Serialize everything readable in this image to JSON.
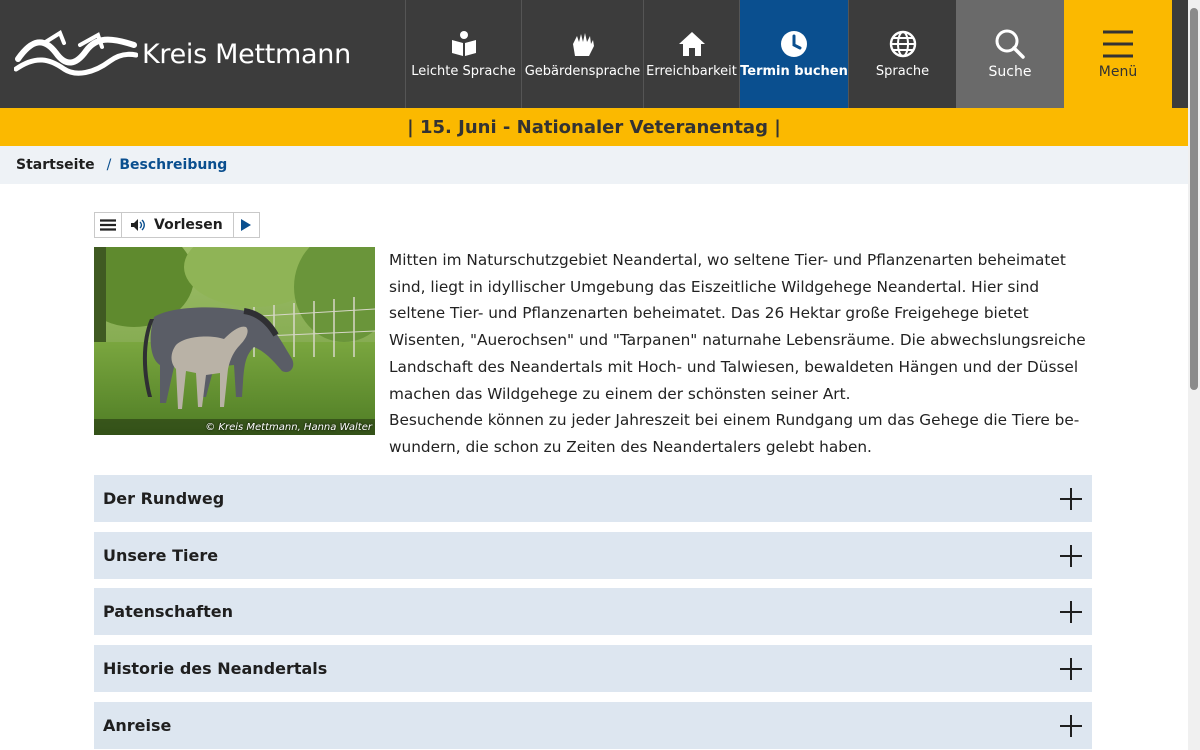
{
  "header": {
    "logo_text": "Kreis Mettmann",
    "nav": [
      {
        "label": "Leichte Sprache",
        "icon": "book-reader-icon"
      },
      {
        "label": "Gebärdensprache",
        "icon": "sign-language-icon"
      },
      {
        "label": "Erreichbarkeit",
        "icon": "home-icon"
      },
      {
        "label": "Termin buchen",
        "icon": "clock-icon"
      },
      {
        "label": "Sprache",
        "icon": "globe-icon"
      },
      {
        "label": "Suche",
        "icon": "search-icon"
      },
      {
        "label": "Menü",
        "icon": "hamburger-icon"
      }
    ]
  },
  "banner": {
    "text": "| 15. Juni - Nationaler Veteranentag |"
  },
  "breadcrumb": {
    "home": "Startseite",
    "separator": "/",
    "current": "Beschreibung"
  },
  "readaloud": {
    "label": "Vorlesen"
  },
  "photo": {
    "credit": "© Kreis Mettmann, Hanna Walter"
  },
  "content": {
    "paragraph1": "Mitten im Naturschutzgebiet Neandertal, wo seltene Tier- und Pflanzenarten beheimatet sind, liegt in idyllischer Umgebung das Eiszeitliche Wildgehege Neandertal. Hier sind seltene Tier- und Pflanzenarten beheimatet. Das 26 Hektar große Freigehege bietet Wisenten, \"Au­erochsen\" und \"Tarpanen\" naturnahe Lebensräume. Die abwechslungsreiche Landschaft des Neandertals mit Hoch- und Talwiesen, bewaldeten Hängen und der Düssel machen das Wild­gehege zu einem der schönsten seiner Art.",
    "paragraph2": "Besuchende können zu jeder Jahreszeit bei einem Rundgang um das Gehege die Tiere be­wundern, die schon zu Zeiten des Neandertalers gelebt haben."
  },
  "accordion": [
    {
      "label": "Der Rundweg"
    },
    {
      "label": "Unsere Tiere"
    },
    {
      "label": "Patenschaften"
    },
    {
      "label": "Historie des Neandertals"
    },
    {
      "label": "Anreise"
    }
  ],
  "colors": {
    "header_bg": "#3c3c3c",
    "accent_yellow": "#fbb900",
    "accent_blue": "#0a4f8f",
    "accordion_bg": "#dde6f0"
  }
}
